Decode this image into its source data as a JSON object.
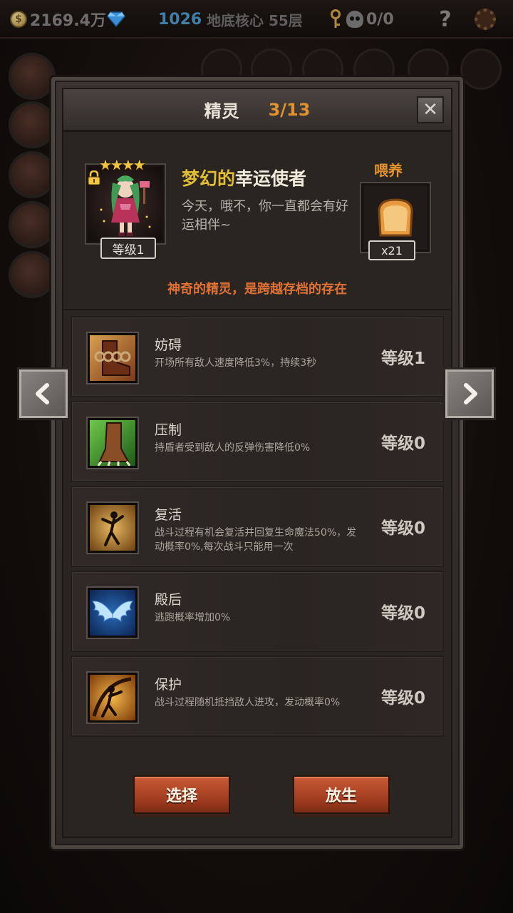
{
  "topbar": {
    "coin_icon": "coin-icon",
    "coins": "2169.4万",
    "gem_icon": "diamond-icon",
    "gems": "1026",
    "location": "地底核心 55层",
    "keys_icon": "key-icon",
    "skull_icon": "skull-icon",
    "keys_count": "0/0",
    "help_icon": "question-mark-icon",
    "settings_icon": "gear-icon",
    "help_glyph": "?"
  },
  "dialog": {
    "title": "精灵",
    "counter": "3/13",
    "close_glyph": "✕"
  },
  "sprite": {
    "stars": "★★★★",
    "star_count": 4,
    "locked": true,
    "level_label": "等级1",
    "name_part1": "梦幻的",
    "name_part2": "幸运使者",
    "description": "今天，哦不，你一直都会有好运相伴~",
    "feed_label": "喂养",
    "feed_item_icon": "bread-icon",
    "feed_count": "x21",
    "note": "神奇的精灵，是跨越存档的存在"
  },
  "skills": [
    {
      "name": "妨碍",
      "description": "开场所有敌人速度降低3%，持续3秒",
      "level": "等级1",
      "icon": "chained-boot-icon"
    },
    {
      "name": "压制",
      "description": "持盾者受到敌人的反弹伤害降低0%",
      "level": "等级0",
      "icon": "beast-claw-icon"
    },
    {
      "name": "复活",
      "description": "战斗过程有机会复活并回复生命魔法50%，发动概率0%,每次战斗只能用一次",
      "level": "等级0",
      "icon": "dancing-figure-icon"
    },
    {
      "name": "殿后",
      "description": "逃跑概率增加0%",
      "level": "等级0",
      "icon": "wings-icon"
    },
    {
      "name": "保护",
      "description": "战斗过程随机抵挡敌人进攻，发动概率0%",
      "level": "等级0",
      "icon": "guardian-figure-icon"
    }
  ],
  "actions": {
    "select": "选择",
    "release": "放生"
  },
  "colors": {
    "accent_orange": "#e3932e",
    "name_gold": "#e0bd34",
    "note_red": "#e07236",
    "button_red": "#9c3a1e"
  }
}
